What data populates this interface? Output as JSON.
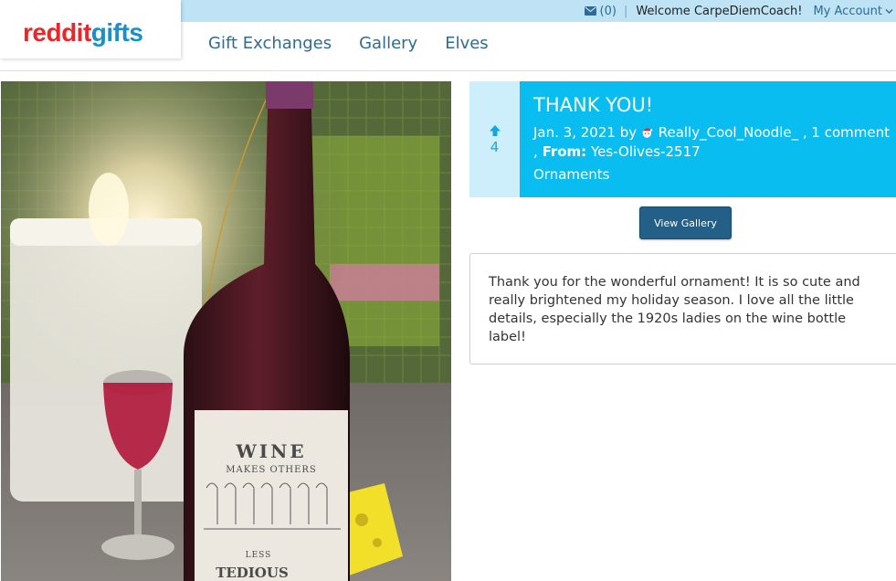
{
  "header": {
    "logo": {
      "part1": "reddit",
      "part2": "gifts"
    },
    "messages_count": "(0)",
    "separator": "|",
    "welcome": "Welcome CarpeDiemCoach!",
    "account_label": "My Account",
    "nav": [
      "Gift Exchanges",
      "Gallery",
      "Elves"
    ]
  },
  "post": {
    "vote_count": "4",
    "title": "THANK YOU!",
    "date": "Jan. 3, 2021",
    "by_label": "by",
    "author": "Really_Cool_Noodle_",
    "comments": ", 1 comment",
    "from_label": "From:",
    "from_user": "Yes-Olives-2517",
    "comma": ",",
    "category": "Ornaments",
    "view_gallery_label": "View Gallery",
    "description": "Thank you for the wonderful ornament! It is so cute and really brightened my holiday season. I love all the little details, especially the 1920s ladies on the wine bottle label!",
    "photo_label": {
      "line1": "WINE",
      "line2": "MAKES OTHERS",
      "line3": "LESS",
      "line4": "TEDIOUS"
    }
  },
  "colors": {
    "brand_red": "#e8272a",
    "brand_blue": "#1b8fc9",
    "topbar": "#bde3f5",
    "panel": "#09bdf0",
    "vote_bg": "#cdeefb",
    "button": "#235f87"
  },
  "icons": [
    "envelope-icon",
    "chevron-down-icon",
    "upvote-arrow-icon",
    "santa-avatar-icon"
  ]
}
